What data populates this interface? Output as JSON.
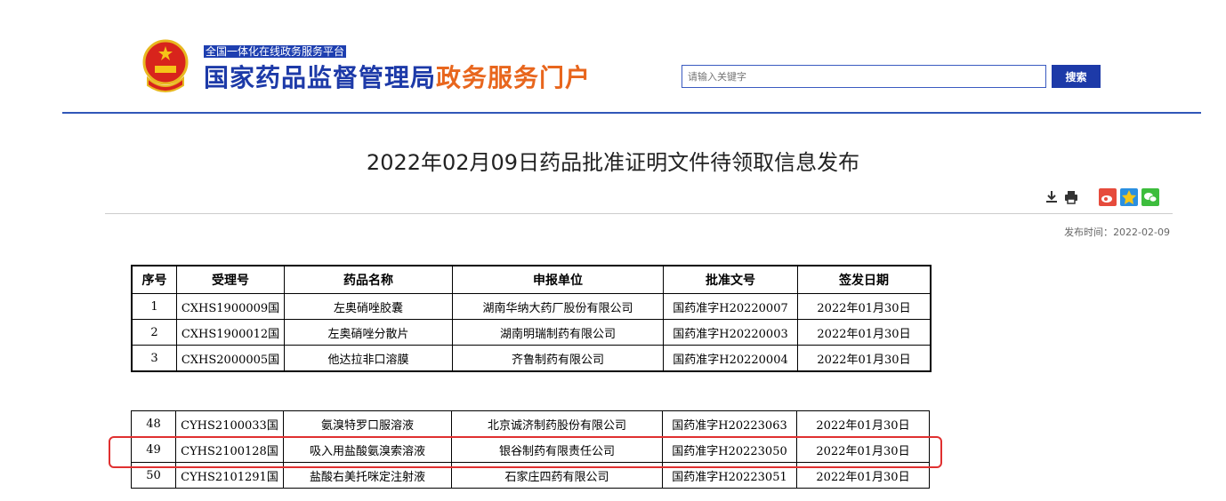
{
  "header": {
    "platform_tag": "全国一体化在线政务服务平台",
    "title_main": "国家药品监督管理局",
    "title_sub": "政务服务门户",
    "search_placeholder": "请输入关键字",
    "search_button": "搜索"
  },
  "article": {
    "title": "2022年02月09日药品批准证明文件待领取信息发布",
    "publish_label": "发布时间：",
    "publish_date": "2022-02-09",
    "tools": [
      "download-icon",
      "print-icon"
    ],
    "share": [
      "weibo-icon",
      "qzone-icon",
      "wechat-icon"
    ]
  },
  "table": {
    "headers": [
      "序号",
      "受理号",
      "药品名称",
      "申报单位",
      "批准文号",
      "签发日期"
    ],
    "rows": [
      [
        "1",
        "CXHS1900009国",
        "左奥硝唑胶囊",
        "湖南华纳大药厂股份有限公司",
        "国药准字H20220007",
        "2022年01月30日"
      ],
      [
        "2",
        "CXHS1900012国",
        "左奥硝唑分散片",
        "湖南明瑞制药有限公司",
        "国药准字H20220003",
        "2022年01月30日"
      ],
      [
        "3",
        "CXHS2000005国",
        "他达拉非口溶膜",
        "齐鲁制药有限公司",
        "国药准字H20220004",
        "2022年01月30日"
      ]
    ],
    "rows_part2": [
      [
        "48",
        "CYHS2100033国",
        "氨溴特罗口服溶液",
        "北京诚济制药股份有限公司",
        "国药准字H20223063",
        "2022年01月30日"
      ],
      [
        "49",
        "CYHS2100128国",
        "吸入用盐酸氨溴索溶液",
        "银谷制药有限责任公司",
        "国药准字H20223050",
        "2022年01月30日"
      ],
      [
        "50",
        "CYHS2101291国",
        "盐酸右美托咪定注射液",
        "石家庄四药有限公司",
        "国药准字H20223051",
        "2022年01月30日"
      ]
    ]
  },
  "colors": {
    "brand_blue": "#1d3aa8",
    "brand_orange": "#e8661d",
    "highlight_red": "#e03030"
  }
}
